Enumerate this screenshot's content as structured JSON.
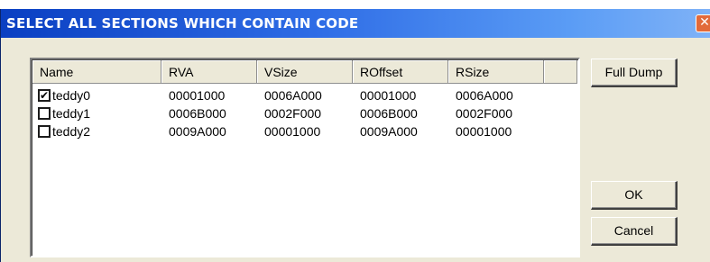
{
  "window": {
    "title": "SELECT ALL SECTIONS WHICH CONTAIN CODE",
    "close_glyph": "✕"
  },
  "list": {
    "columns": [
      "Name",
      "RVA",
      "VSize",
      "ROffset",
      "RSize",
      ""
    ],
    "rows": [
      {
        "checked": true,
        "name": "teddy0",
        "rva": "00001000",
        "vsize": "0006A000",
        "roffset": "00001000",
        "rsize": "0006A000"
      },
      {
        "checked": false,
        "name": "teddy1",
        "rva": "0006B000",
        "vsize": "0002F000",
        "roffset": "0006B000",
        "rsize": "0002F000"
      },
      {
        "checked": false,
        "name": "teddy2",
        "rva": "0009A000",
        "vsize": "00001000",
        "roffset": "0009A000",
        "rsize": "00001000"
      }
    ],
    "check_glyph": "✔"
  },
  "buttons": {
    "full_dump": "Full Dump",
    "ok": "OK",
    "cancel": "Cancel"
  }
}
